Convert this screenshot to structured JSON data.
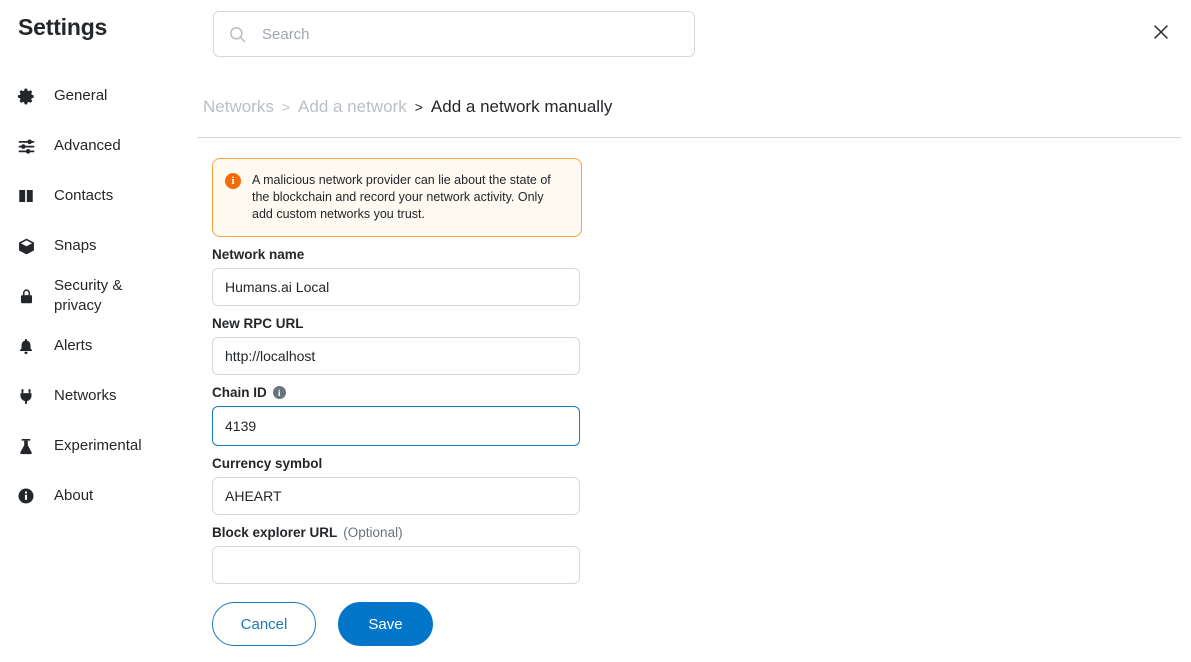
{
  "sidebar": {
    "title": "Settings",
    "items": [
      {
        "label": "General",
        "icon": "gear-icon"
      },
      {
        "label": "Advanced",
        "icon": "sliders-icon"
      },
      {
        "label": "Contacts",
        "icon": "address-book-icon"
      },
      {
        "label": "Snaps",
        "icon": "cube-icon"
      },
      {
        "label": "Security &\nprivacy",
        "icon": "lock-icon"
      },
      {
        "label": "Alerts",
        "icon": "bell-icon"
      },
      {
        "label": "Networks",
        "icon": "plug-icon"
      },
      {
        "label": "Experimental",
        "icon": "flask-icon"
      },
      {
        "label": "About",
        "icon": "info-circle-icon"
      }
    ]
  },
  "header": {
    "search_placeholder": "Search",
    "search_value": "",
    "search_icon": "search-icon",
    "close_icon": "close-icon"
  },
  "breadcrumb": {
    "networks": "Networks",
    "sep1": ">",
    "add_a_network": "Add a network",
    "sep2": ">",
    "current": "Add a network manually"
  },
  "warning": {
    "icon": "info-circle-icon",
    "icon_glyph": "i",
    "text": "A malicious network provider can lie about the state of the blockchain and record your network activity. Only add custom networks you trust.",
    "border_color": "#f8a33c",
    "background_color": "#fefaf1",
    "icon_color": "#f66a0a"
  },
  "form": {
    "network_name": {
      "label": "Network name",
      "value": "Humans.ai Local",
      "placeholder": ""
    },
    "rpc_url": {
      "label": "New RPC URL",
      "value": "http://localhost",
      "placeholder": ""
    },
    "chain_id": {
      "label": "Chain ID",
      "value": "4139",
      "placeholder": "",
      "info_glyph": "i",
      "focused": true,
      "focus_color": "#1b7aba"
    },
    "currency_symbol": {
      "label": "Currency symbol",
      "value": "AHEART",
      "placeholder": ""
    },
    "block_explorer_url": {
      "label": "Block explorer URL",
      "optional": "(Optional)",
      "value": "",
      "placeholder": ""
    }
  },
  "buttons": {
    "cancel": "Cancel",
    "save": "Save",
    "save_color": "#0376c9",
    "cancel_color": "#1b7aba"
  }
}
